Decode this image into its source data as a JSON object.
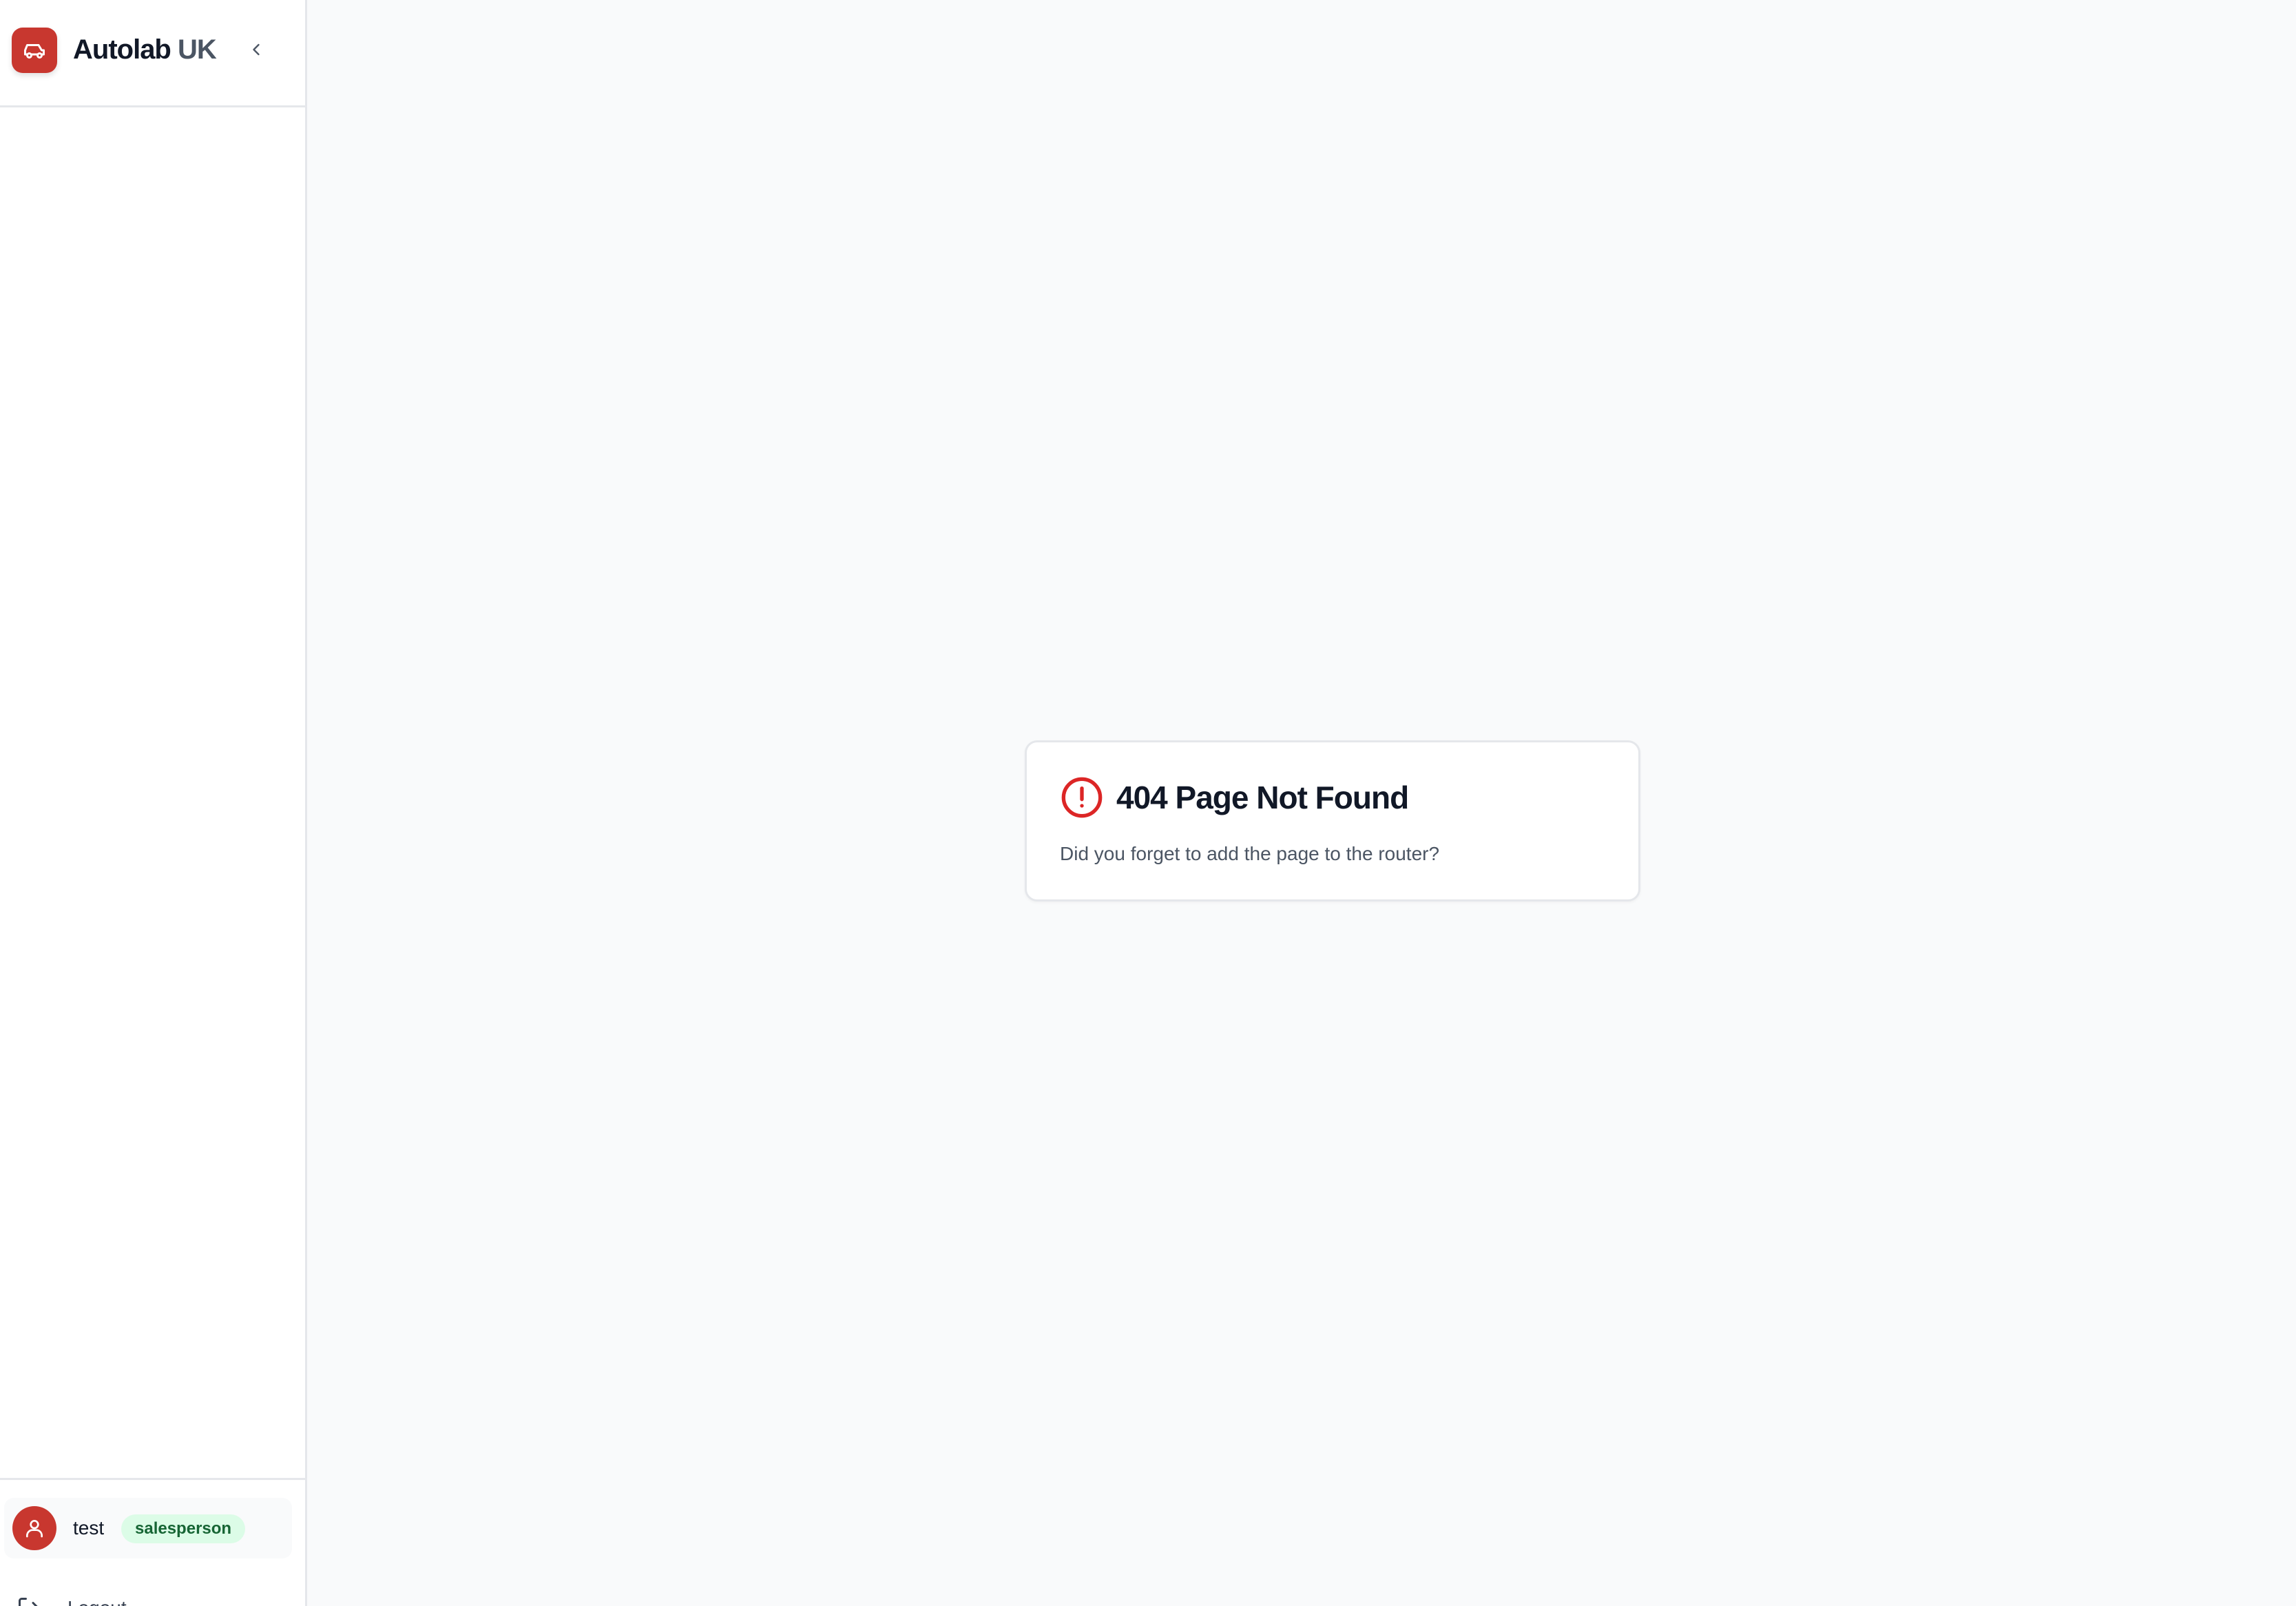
{
  "brand": {
    "name": "Autolab",
    "suffix": "UK",
    "logo_icon": "car-icon",
    "accent_color": "#c8372f"
  },
  "sidebar": {
    "collapse_icon": "chevron-left-icon",
    "user": {
      "name": "test",
      "role": "salesperson",
      "avatar_icon": "user-icon"
    },
    "logout": {
      "label": "Logout",
      "icon": "logout-icon"
    }
  },
  "error": {
    "icon": "alert-circle-icon",
    "title": "404 Page Not Found",
    "message": "Did you forget to add the page to the router?"
  }
}
